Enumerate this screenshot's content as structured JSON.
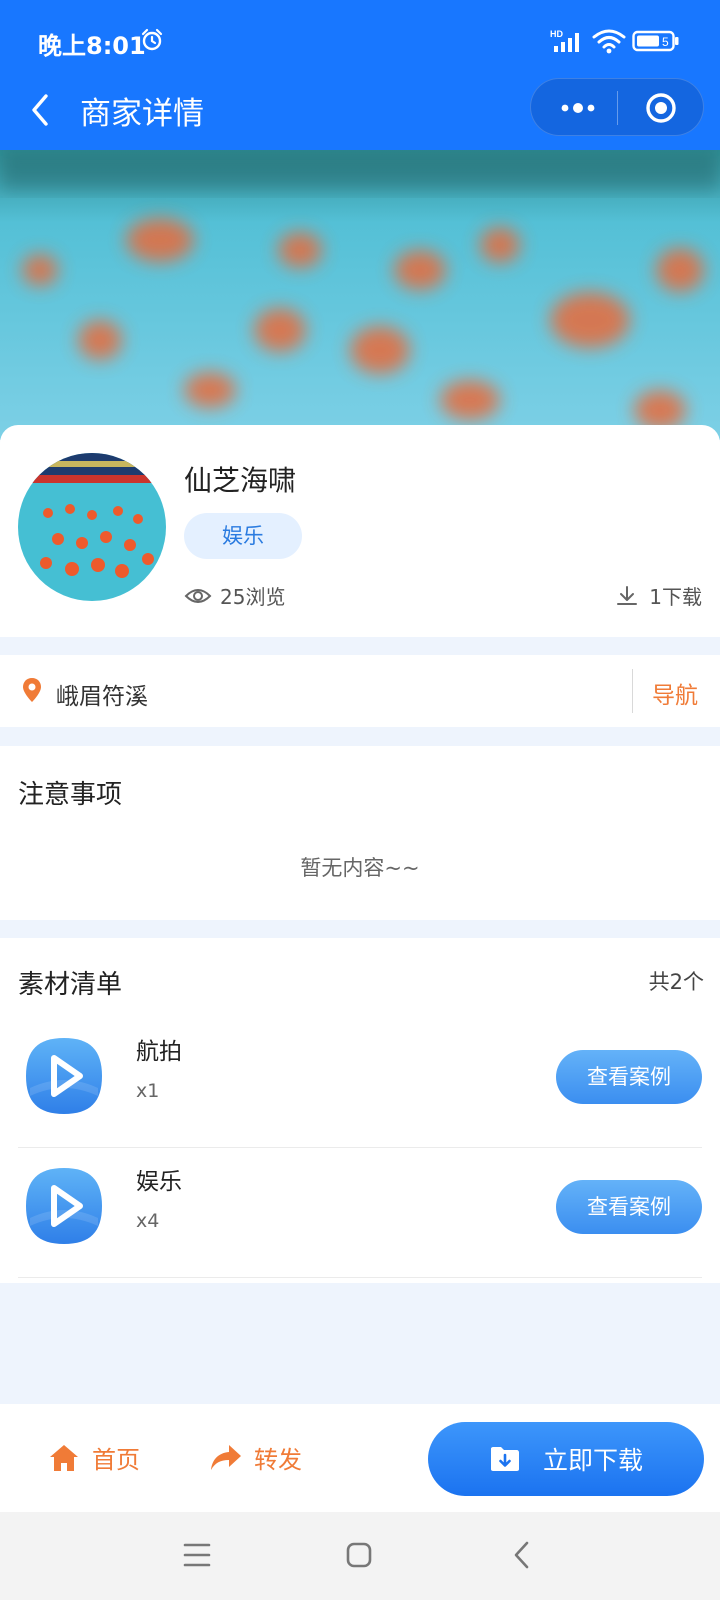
{
  "status_bar": {
    "time": "晚上8:01",
    "network": "HD",
    "battery": "5"
  },
  "nav": {
    "title": "商家详情"
  },
  "merchant": {
    "name": "仙芝海啸",
    "tag": "娱乐",
    "views": "25浏览",
    "downloads": "1下载"
  },
  "address": {
    "text": "峨眉符溪",
    "nav_label": "导航"
  },
  "notes": {
    "title": "注意事项",
    "empty_text": "暂无内容~~"
  },
  "materials": {
    "title": "素材清单",
    "count": "共2个",
    "items": [
      {
        "name": "航拍",
        "qty": "x1",
        "button": "查看案例"
      },
      {
        "name": "娱乐",
        "qty": "x4",
        "button": "查看案例"
      }
    ]
  },
  "bottom_bar": {
    "home": "首页",
    "share": "转发",
    "download": "立即下载"
  },
  "colors": {
    "primary": "#1877ff",
    "accent": "#f07b37",
    "page_bg": "#eef4fd"
  },
  "icons": [
    "alarm-icon",
    "signal-icon",
    "wifi-icon",
    "battery-icon",
    "back-arrow-icon",
    "more-icon",
    "target-icon",
    "eye-icon",
    "download-icon",
    "location-pin-icon",
    "play-icon",
    "home-icon",
    "share-icon",
    "download-folder-icon"
  ]
}
